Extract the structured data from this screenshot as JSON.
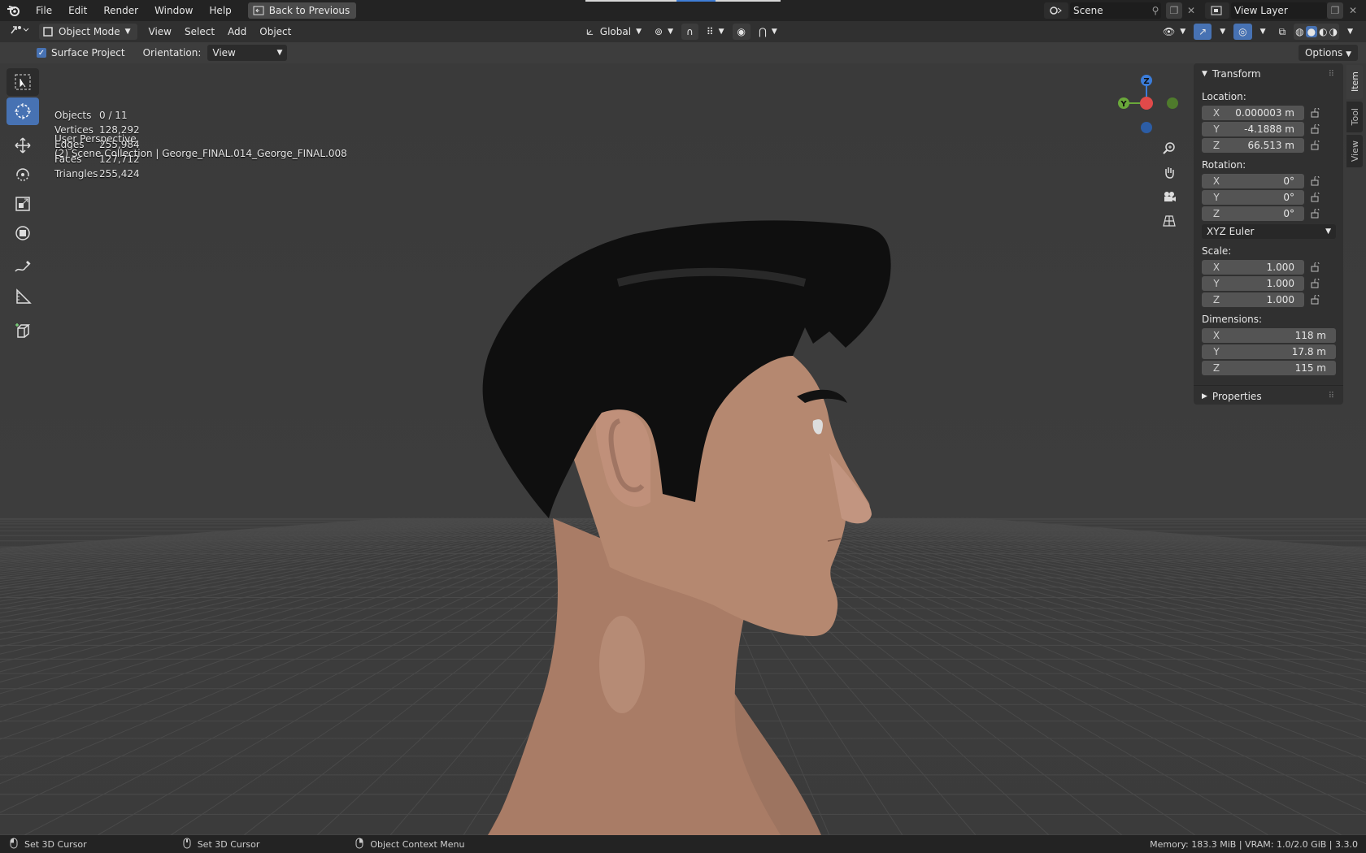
{
  "menubar": {
    "items": [
      "File",
      "Edit",
      "Render",
      "Window",
      "Help"
    ],
    "back_button": "Back to Previous",
    "scene_name": "Scene",
    "view_layer": "View Layer"
  },
  "header": {
    "mode": "Object Mode",
    "menus": [
      "View",
      "Select",
      "Add",
      "Object"
    ],
    "transform_orientation": "Global"
  },
  "tool_settings": {
    "surface_project_label": "Surface Project",
    "surface_project_checked": true,
    "orientation_label": "Orientation:",
    "orientation_value": "View",
    "options_label": "Options"
  },
  "viewport": {
    "view_name": "User Perspective",
    "collection_info": "(2) Scene Collection | George_FINAL.014_George_FINAL.008",
    "stats": [
      {
        "label": "Objects",
        "value": "0 / 11"
      },
      {
        "label": "Vertices",
        "value": "128,292"
      },
      {
        "label": "Edges",
        "value": "255,984"
      },
      {
        "label": "Faces",
        "value": "127,712"
      },
      {
        "label": "Triangles",
        "value": "255,424"
      }
    ],
    "gizmo_axes": {
      "z": "Z",
      "y": "Y"
    }
  },
  "npanel": {
    "tabs": [
      "Item",
      "Tool",
      "View"
    ],
    "transform_title": "Transform",
    "location_label": "Location:",
    "location": [
      {
        "axis": "X",
        "value": "0.000003 m"
      },
      {
        "axis": "Y",
        "value": "-4.1888 m"
      },
      {
        "axis": "Z",
        "value": "66.513 m"
      }
    ],
    "rotation_label": "Rotation:",
    "rotation": [
      {
        "axis": "X",
        "value": "0°"
      },
      {
        "axis": "Y",
        "value": "0°"
      },
      {
        "axis": "Z",
        "value": "0°"
      }
    ],
    "rotation_mode": "XYZ Euler",
    "scale_label": "Scale:",
    "scale": [
      {
        "axis": "X",
        "value": "1.000"
      },
      {
        "axis": "Y",
        "value": "1.000"
      },
      {
        "axis": "Z",
        "value": "1.000"
      }
    ],
    "dimensions_label": "Dimensions:",
    "dimensions": [
      {
        "axis": "X",
        "value": "118 m"
      },
      {
        "axis": "Y",
        "value": "17.8 m"
      },
      {
        "axis": "Z",
        "value": "115 m"
      }
    ],
    "properties_title": "Properties"
  },
  "statusbar": {
    "left_click": "Set 3D Cursor",
    "middle_click": "Set 3D Cursor",
    "right_click": "Object Context Menu",
    "info": "Memory: 183.3 MiB | VRAM: 1.0/2.0 GiB | 3.3.0"
  },
  "colors": {
    "accent": "#4772b3",
    "axis_x": "#e04a4a",
    "axis_y": "#6aa83a",
    "axis_z": "#3b7ddb",
    "hair": "#0f0f0f",
    "skin": "#b58870"
  }
}
